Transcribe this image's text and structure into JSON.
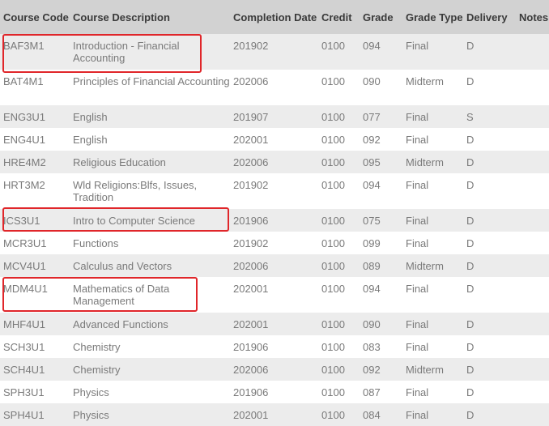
{
  "headers": {
    "code": "Course Code",
    "description": "Course Description",
    "date": "Completion Date",
    "credit": "Credit",
    "grade": "Grade",
    "type": "Grade Type",
    "delivery": "Delivery",
    "notes": "Notes"
  },
  "highlight_color": "#e0262a",
  "rows": [
    {
      "code": "BAF3M1",
      "description": "Introduction - Financial Accounting",
      "date": "201902",
      "credit": "0100",
      "grade": "094",
      "type": "Final",
      "delivery": "D",
      "notes": "",
      "highlighted": true
    },
    {
      "code": "BAT4M1",
      "description": "Principles of Financial Accounting",
      "date": "202006",
      "credit": "0100",
      "grade": "090",
      "type": "Midterm",
      "delivery": "D",
      "notes": "",
      "highlighted": false
    },
    {
      "code": "ENG3U1",
      "description": "English",
      "date": "201907",
      "credit": "0100",
      "grade": "077",
      "type": "Final",
      "delivery": "S",
      "notes": "",
      "highlighted": false
    },
    {
      "code": "ENG4U1",
      "description": "English",
      "date": "202001",
      "credit": "0100",
      "grade": "092",
      "type": "Final",
      "delivery": "D",
      "notes": "",
      "highlighted": false
    },
    {
      "code": "HRE4M2",
      "description": "Religious Education",
      "date": "202006",
      "credit": "0100",
      "grade": "095",
      "type": "Midterm",
      "delivery": "D",
      "notes": "",
      "highlighted": false
    },
    {
      "code": "HRT3M2",
      "description": "Wld Religions:Blfs, Issues, Tradition",
      "date": "201902",
      "credit": "0100",
      "grade": "094",
      "type": "Final",
      "delivery": "D",
      "notes": "",
      "highlighted": false
    },
    {
      "code": "ICS3U1",
      "description": "Intro to Computer Science",
      "date": "201906",
      "credit": "0100",
      "grade": "075",
      "type": "Final",
      "delivery": "D",
      "notes": "",
      "highlighted": true
    },
    {
      "code": "MCR3U1",
      "description": "Functions",
      "date": "201902",
      "credit": "0100",
      "grade": "099",
      "type": "Final",
      "delivery": "D",
      "notes": "",
      "highlighted": false
    },
    {
      "code": "MCV4U1",
      "description": "Calculus and Vectors",
      "date": "202006",
      "credit": "0100",
      "grade": "089",
      "type": "Midterm",
      "delivery": "D",
      "notes": "",
      "highlighted": false
    },
    {
      "code": "MDM4U1",
      "description": "Mathematics of Data Management",
      "date": "202001",
      "credit": "0100",
      "grade": "094",
      "type": "Final",
      "delivery": "D",
      "notes": "",
      "highlighted": true
    },
    {
      "code": "MHF4U1",
      "description": "Advanced Functions",
      "date": "202001",
      "credit": "0100",
      "grade": "090",
      "type": "Final",
      "delivery": "D",
      "notes": "",
      "highlighted": false
    },
    {
      "code": "SCH3U1",
      "description": "Chemistry",
      "date": "201906",
      "credit": "0100",
      "grade": "083",
      "type": "Final",
      "delivery": "D",
      "notes": "",
      "highlighted": false
    },
    {
      "code": "SCH4U1",
      "description": "Chemistry",
      "date": "202006",
      "credit": "0100",
      "grade": "092",
      "type": "Midterm",
      "delivery": "D",
      "notes": "",
      "highlighted": false
    },
    {
      "code": "SPH3U1",
      "description": "Physics",
      "date": "201906",
      "credit": "0100",
      "grade": "087",
      "type": "Final",
      "delivery": "D",
      "notes": "",
      "highlighted": false
    },
    {
      "code": "SPH4U1",
      "description": "Physics",
      "date": "202001",
      "credit": "0100",
      "grade": "084",
      "type": "Final",
      "delivery": "D",
      "notes": "",
      "highlighted": false
    }
  ]
}
